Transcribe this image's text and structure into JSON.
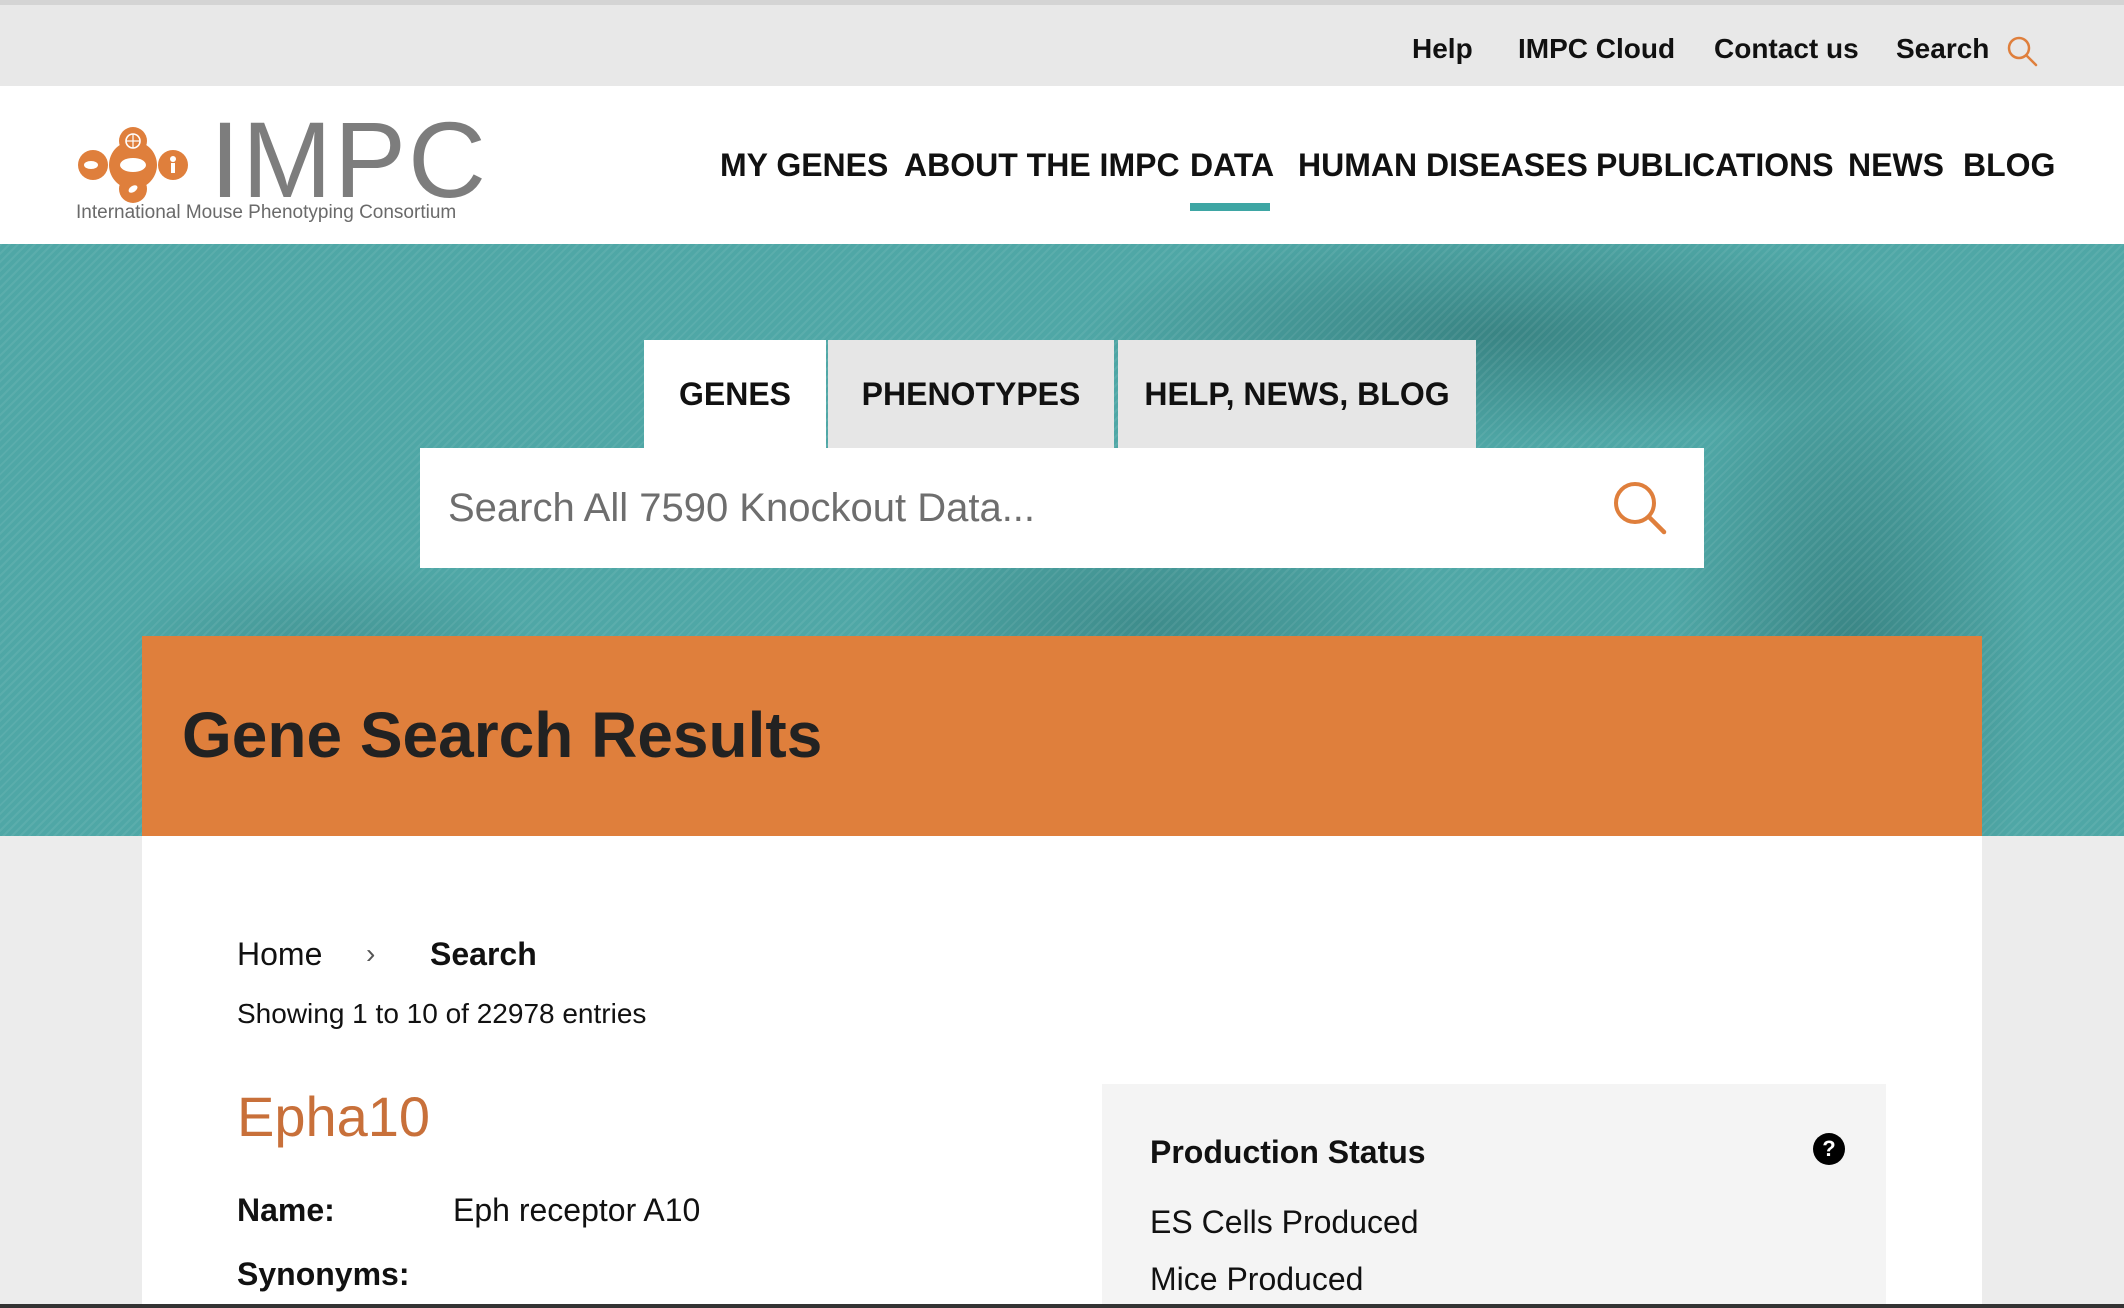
{
  "utility_nav": {
    "help": "Help",
    "cloud": "IMPC Cloud",
    "contact": "Contact us",
    "search": "Search"
  },
  "logo": {
    "wordmark": "IMPC",
    "subtitle": "International Mouse Phenotyping Consortium"
  },
  "main_nav": {
    "items": [
      "MY GENES",
      "ABOUT THE IMPC",
      "DATA",
      "HUMAN DISEASES",
      "PUBLICATIONS",
      "NEWS",
      "BLOG"
    ],
    "active": "DATA"
  },
  "search": {
    "tabs": [
      "GENES",
      "PHENOTYPES",
      "HELP, NEWS, BLOG"
    ],
    "active_tab": "GENES",
    "placeholder": "Search All 7590 Knockout Data..."
  },
  "results": {
    "title": "Gene Search Results",
    "breadcrumb": {
      "home": "Home",
      "separator": "›",
      "current": "Search"
    },
    "showing": "Showing 1 to 10 of 22978 entries"
  },
  "gene": {
    "symbol": "Epha10",
    "name_label": "Name:",
    "name_value": "Eph receptor A10",
    "synonyms_label": "Synonyms:"
  },
  "production_status": {
    "title": "Production Status",
    "lines": [
      "ES Cells Produced",
      "Mice Produced"
    ]
  },
  "colors": {
    "teal": "#4fa7a6",
    "orange": "#df7f3c",
    "gene_link": "#c8703a",
    "nav_underline": "#3ea6a4"
  }
}
